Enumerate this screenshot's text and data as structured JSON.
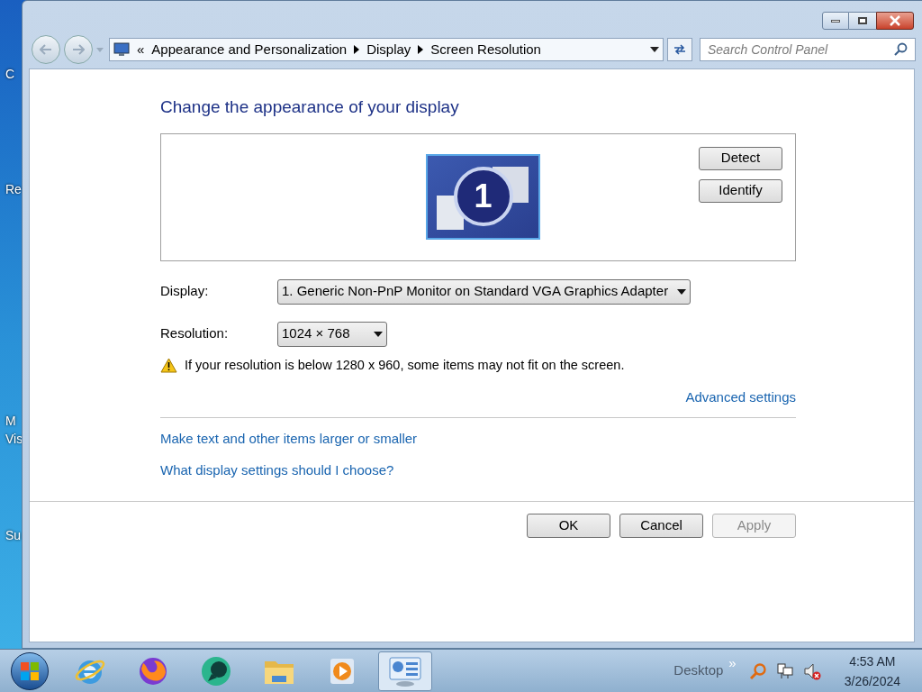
{
  "desktop": {
    "icon_labels": [
      "C",
      "Re",
      "M",
      "Vis",
      "Su"
    ]
  },
  "address_bar": {
    "overflow": "«",
    "crumbs": [
      "Appearance and Personalization",
      "Display",
      "Screen Resolution"
    ]
  },
  "search": {
    "placeholder": "Search Control Panel"
  },
  "heading": "Change the appearance of your display",
  "monitor": {
    "number": "1",
    "selected": true
  },
  "monitor_buttons": [
    "Detect",
    "Identify"
  ],
  "fields": [
    {
      "label": "Display:",
      "value": "1. Generic Non-PnP Monitor on Standard VGA Graphics Adapter"
    },
    {
      "label": "Resolution:",
      "value": "1024 × 768"
    }
  ],
  "warning": "If your resolution is below 1280 x 960, some items may not fit on the screen.",
  "advanced_link": "Advanced settings",
  "links": [
    "Make text and other items larger or smaller",
    "What display settings should I choose?"
  ],
  "buttons": [
    {
      "label": "OK",
      "disabled": false
    },
    {
      "label": "Cancel",
      "disabled": false
    },
    {
      "label": "Apply",
      "disabled": true
    }
  ],
  "taskbar": {
    "apps": [
      {
        "kind": "browser-e",
        "selected": false
      },
      {
        "kind": "fox",
        "selected": false
      },
      {
        "kind": "green",
        "selected": false
      },
      {
        "kind": "folder",
        "selected": false
      },
      {
        "kind": "media",
        "selected": false
      },
      {
        "kind": "panel",
        "selected": true
      }
    ],
    "toolbar": "Desktop",
    "overflow": "»",
    "time": "4:53 AM",
    "date": "3/26/2024"
  }
}
